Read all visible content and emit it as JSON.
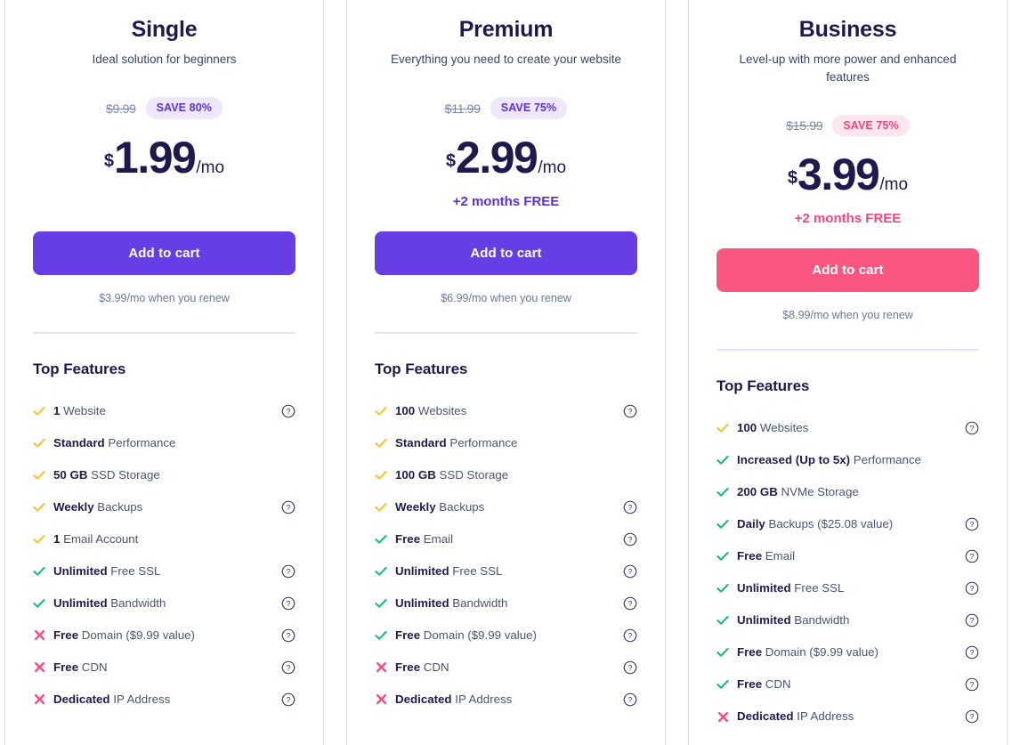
{
  "colors": {
    "purple": "#673de6",
    "purple_text": "#5c2fe0",
    "pink": "#f9577f",
    "pink_text": "#f4467e",
    "navy": "#1f1a4d",
    "check_yellow": "#f5c13b",
    "check_green": "#19b982",
    "cross_pink": "#f6487d",
    "divider": "#dce6f8"
  },
  "plans": [
    {
      "name": "Single",
      "tagline": "Ideal solution for beginners",
      "old_price": "$9.99",
      "save_badge": "SAVE 80%",
      "badge_style": "purple",
      "currency": "$",
      "amount": "1.99",
      "period": "/mo",
      "free_months": "",
      "cta_label": "Add to cart",
      "cta_style": "purple",
      "renew_note": "$3.99/mo when you renew",
      "features_title": "Top Features",
      "features": [
        {
          "mark": "check-yellow",
          "strong": "1",
          "rest": " Website",
          "help": true
        },
        {
          "mark": "check-yellow",
          "strong": "Standard",
          "rest": " Performance",
          "help": false
        },
        {
          "mark": "check-yellow",
          "strong": "50 GB",
          "rest": " SSD Storage",
          "help": false
        },
        {
          "mark": "check-yellow",
          "strong": "Weekly",
          "rest": " Backups",
          "help": true
        },
        {
          "mark": "check-yellow",
          "strong": "1",
          "rest": " Email Account",
          "help": false
        },
        {
          "mark": "check-green",
          "strong": "Unlimited",
          "rest": " Free SSL",
          "help": true
        },
        {
          "mark": "check-green",
          "strong": "Unlimited",
          "rest": " Bandwidth",
          "help": true
        },
        {
          "mark": "cross",
          "strong": "Free",
          "rest": " Domain ($9.99 value)",
          "help": true
        },
        {
          "mark": "cross",
          "strong": "Free",
          "rest": " CDN",
          "help": true
        },
        {
          "mark": "cross",
          "strong": "Dedicated",
          "rest": " IP Address",
          "help": true
        }
      ]
    },
    {
      "name": "Premium",
      "tagline": "Everything you need to create your website",
      "old_price": "$11.99",
      "save_badge": "SAVE 75%",
      "badge_style": "purple",
      "currency": "$",
      "amount": "2.99",
      "period": "/mo",
      "free_months": "+2 months FREE",
      "cta_label": "Add to cart",
      "cta_style": "purple",
      "renew_note": "$6.99/mo when you renew",
      "features_title": "Top Features",
      "features": [
        {
          "mark": "check-yellow",
          "strong": "100",
          "rest": " Websites",
          "help": true
        },
        {
          "mark": "check-yellow",
          "strong": "Standard",
          "rest": " Performance",
          "help": false
        },
        {
          "mark": "check-yellow",
          "strong": "100 GB",
          "rest": " SSD Storage",
          "help": false
        },
        {
          "mark": "check-yellow",
          "strong": "Weekly",
          "rest": " Backups",
          "help": true
        },
        {
          "mark": "check-green",
          "strong": "Free",
          "rest": " Email",
          "help": true
        },
        {
          "mark": "check-green",
          "strong": "Unlimited",
          "rest": " Free SSL",
          "help": true
        },
        {
          "mark": "check-green",
          "strong": "Unlimited",
          "rest": " Bandwidth",
          "help": true
        },
        {
          "mark": "check-green",
          "strong": "Free",
          "rest": " Domain ($9.99 value)",
          "help": true
        },
        {
          "mark": "cross",
          "strong": "Free",
          "rest": " CDN",
          "help": true
        },
        {
          "mark": "cross",
          "strong": "Dedicated",
          "rest": " IP Address",
          "help": true
        }
      ]
    },
    {
      "name": "Business",
      "tagline": "Level-up with more power and enhanced features",
      "old_price": "$15.99",
      "save_badge": "SAVE 75%",
      "badge_style": "pink",
      "currency": "$",
      "amount": "3.99",
      "period": "/mo",
      "free_months": "+2 months FREE",
      "cta_label": "Add to cart",
      "cta_style": "pink",
      "renew_note": "$8.99/mo when you renew",
      "features_title": "Top Features",
      "features": [
        {
          "mark": "check-yellow",
          "strong": "100",
          "rest": " Websites",
          "help": true
        },
        {
          "mark": "check-green",
          "strong": "Increased (Up to 5x)",
          "rest": " Performance",
          "help": false
        },
        {
          "mark": "check-green",
          "strong": "200 GB",
          "rest": " NVMe Storage",
          "help": false
        },
        {
          "mark": "check-green",
          "strong": "Daily",
          "rest": " Backups ($25.08 value)",
          "help": true
        },
        {
          "mark": "check-green",
          "strong": "Free",
          "rest": " Email",
          "help": true
        },
        {
          "mark": "check-green",
          "strong": "Unlimited",
          "rest": " Free SSL",
          "help": true
        },
        {
          "mark": "check-green",
          "strong": "Unlimited",
          "rest": " Bandwidth",
          "help": true
        },
        {
          "mark": "check-green",
          "strong": "Free",
          "rest": " Domain ($9.99 value)",
          "help": true
        },
        {
          "mark": "check-green",
          "strong": "Free",
          "rest": " CDN",
          "help": true
        },
        {
          "mark": "cross",
          "strong": "Dedicated",
          "rest": " IP Address",
          "help": true
        }
      ]
    }
  ]
}
